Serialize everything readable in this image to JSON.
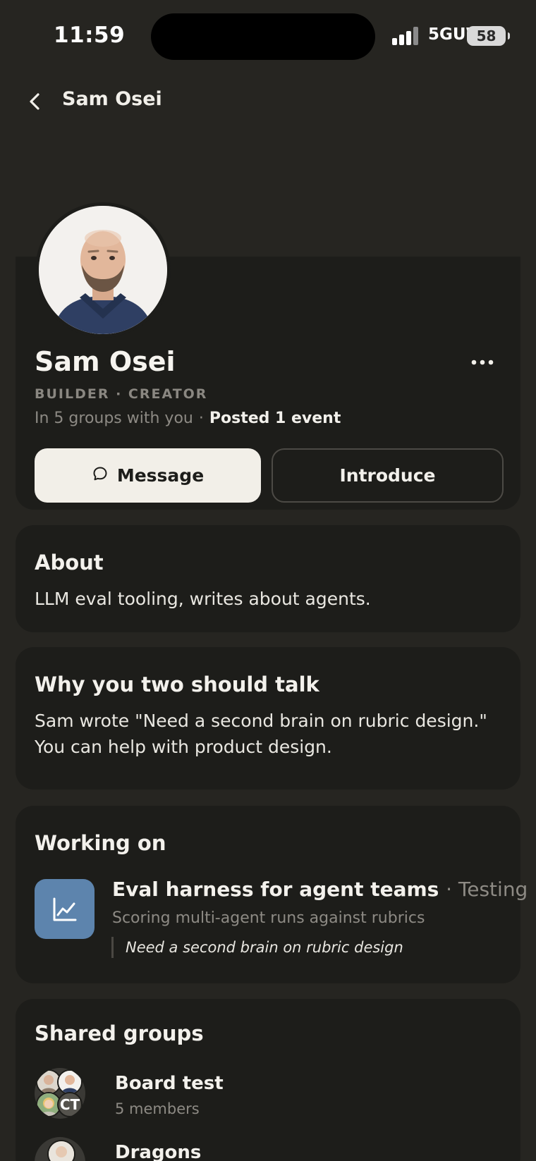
{
  "status_bar": {
    "time": "11:59",
    "network": "5GUW",
    "battery": "58"
  },
  "nav": {
    "title": "Sam Osei"
  },
  "profile": {
    "name": "Sam Osei",
    "roles": "BUILDER · CREATOR",
    "groups_with_you": "In 5 groups with you",
    "separator": "·",
    "posted": "Posted 1 event",
    "message_label": "Message",
    "introduce_label": "Introduce"
  },
  "about": {
    "title": "About",
    "text": "LLM eval tooling, writes about agents."
  },
  "why": {
    "title": "Why you two should talk",
    "text": "Sam wrote \"Need a second brain on rubric design.\" You can help with product design."
  },
  "working_on": {
    "title": "Working on",
    "project": {
      "title": "Eval harness for agent teams",
      "status": "· Testing",
      "subtitle": "Scoring multi-agent runs against rubrics",
      "quote": "Need a second brain on rubric design"
    }
  },
  "shared_groups": {
    "title": "Shared groups",
    "items": [
      {
        "name": "Board test",
        "members": "5 members",
        "initials": "CT"
      },
      {
        "name": "Dragons",
        "members": ""
      }
    ]
  },
  "colors": {
    "background": "#262521",
    "card": "#1d1d1a",
    "primary_button": "#f2efe8",
    "project_icon": "#5d84ad",
    "muted_text": "#8d8a84"
  },
  "icons": {
    "back": "chevron-left-icon",
    "more": "more-dots-icon",
    "message": "chat-bubble-icon",
    "project": "trending-chart-icon"
  }
}
